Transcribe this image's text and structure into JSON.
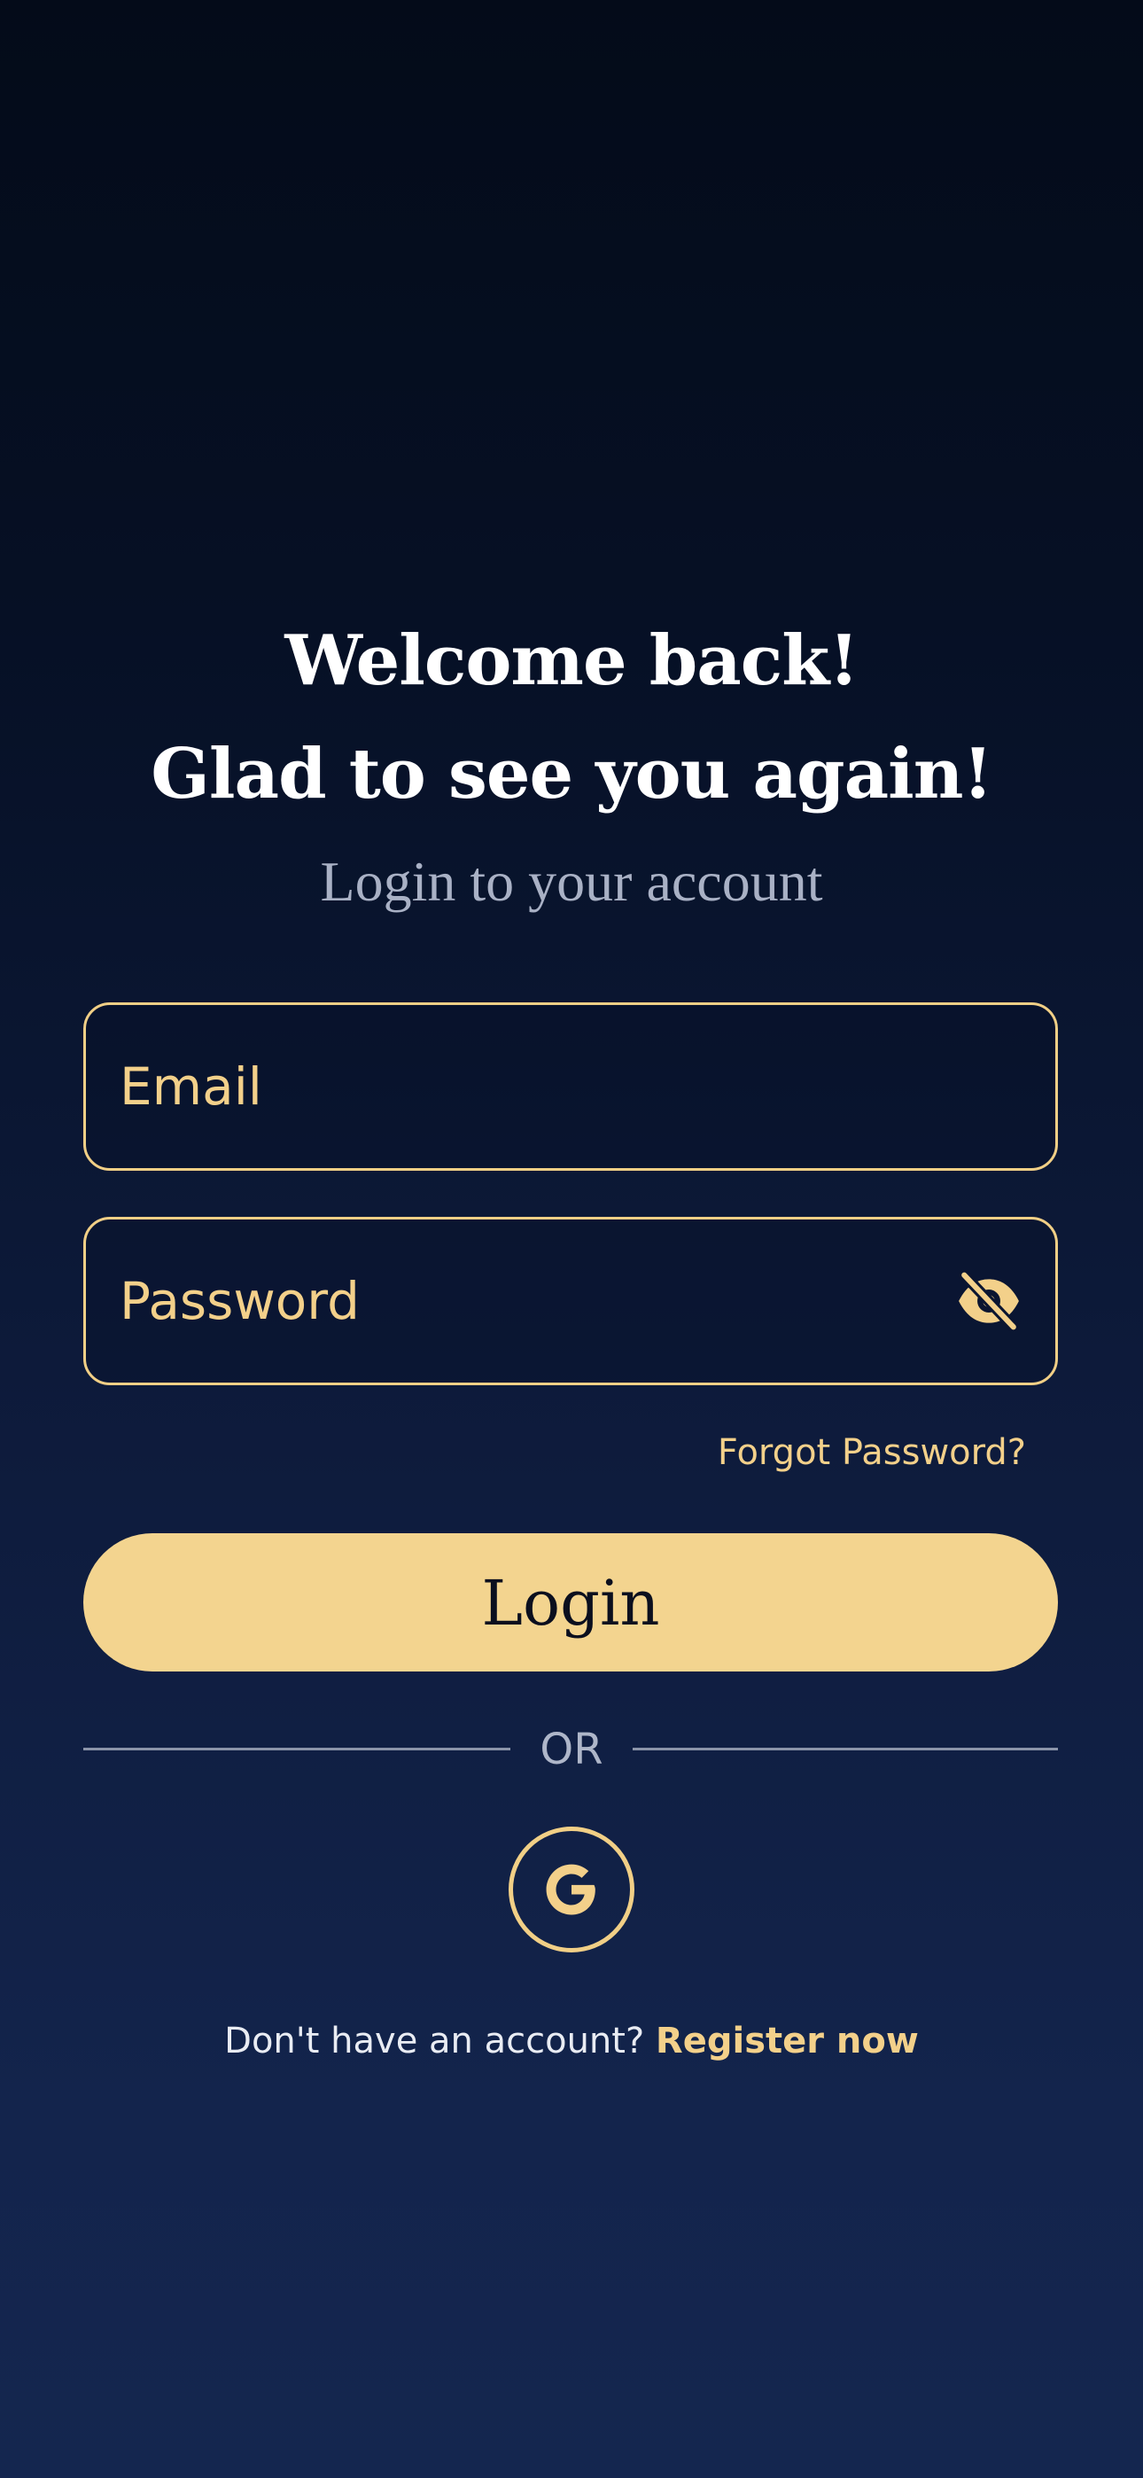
{
  "header": {
    "line1": "Welcome back!",
    "line2": "Glad to see you again!",
    "subtitle": "Login to your account"
  },
  "form": {
    "email": {
      "placeholder": "Email",
      "value": ""
    },
    "password": {
      "placeholder": "Password",
      "value": "",
      "visibility_icon": "eye-off-icon"
    },
    "forgot_label": "Forgot Password?",
    "login_label": "Login"
  },
  "divider": {
    "label": "OR"
  },
  "social": {
    "google_icon": "google-icon"
  },
  "footer": {
    "prompt": "Don't have an account?",
    "register_label": "Register now"
  },
  "colors": {
    "accent": "#f3d08a",
    "button": "#f3d48f",
    "background_top": "#040b19",
    "background_bottom": "#14264f"
  }
}
